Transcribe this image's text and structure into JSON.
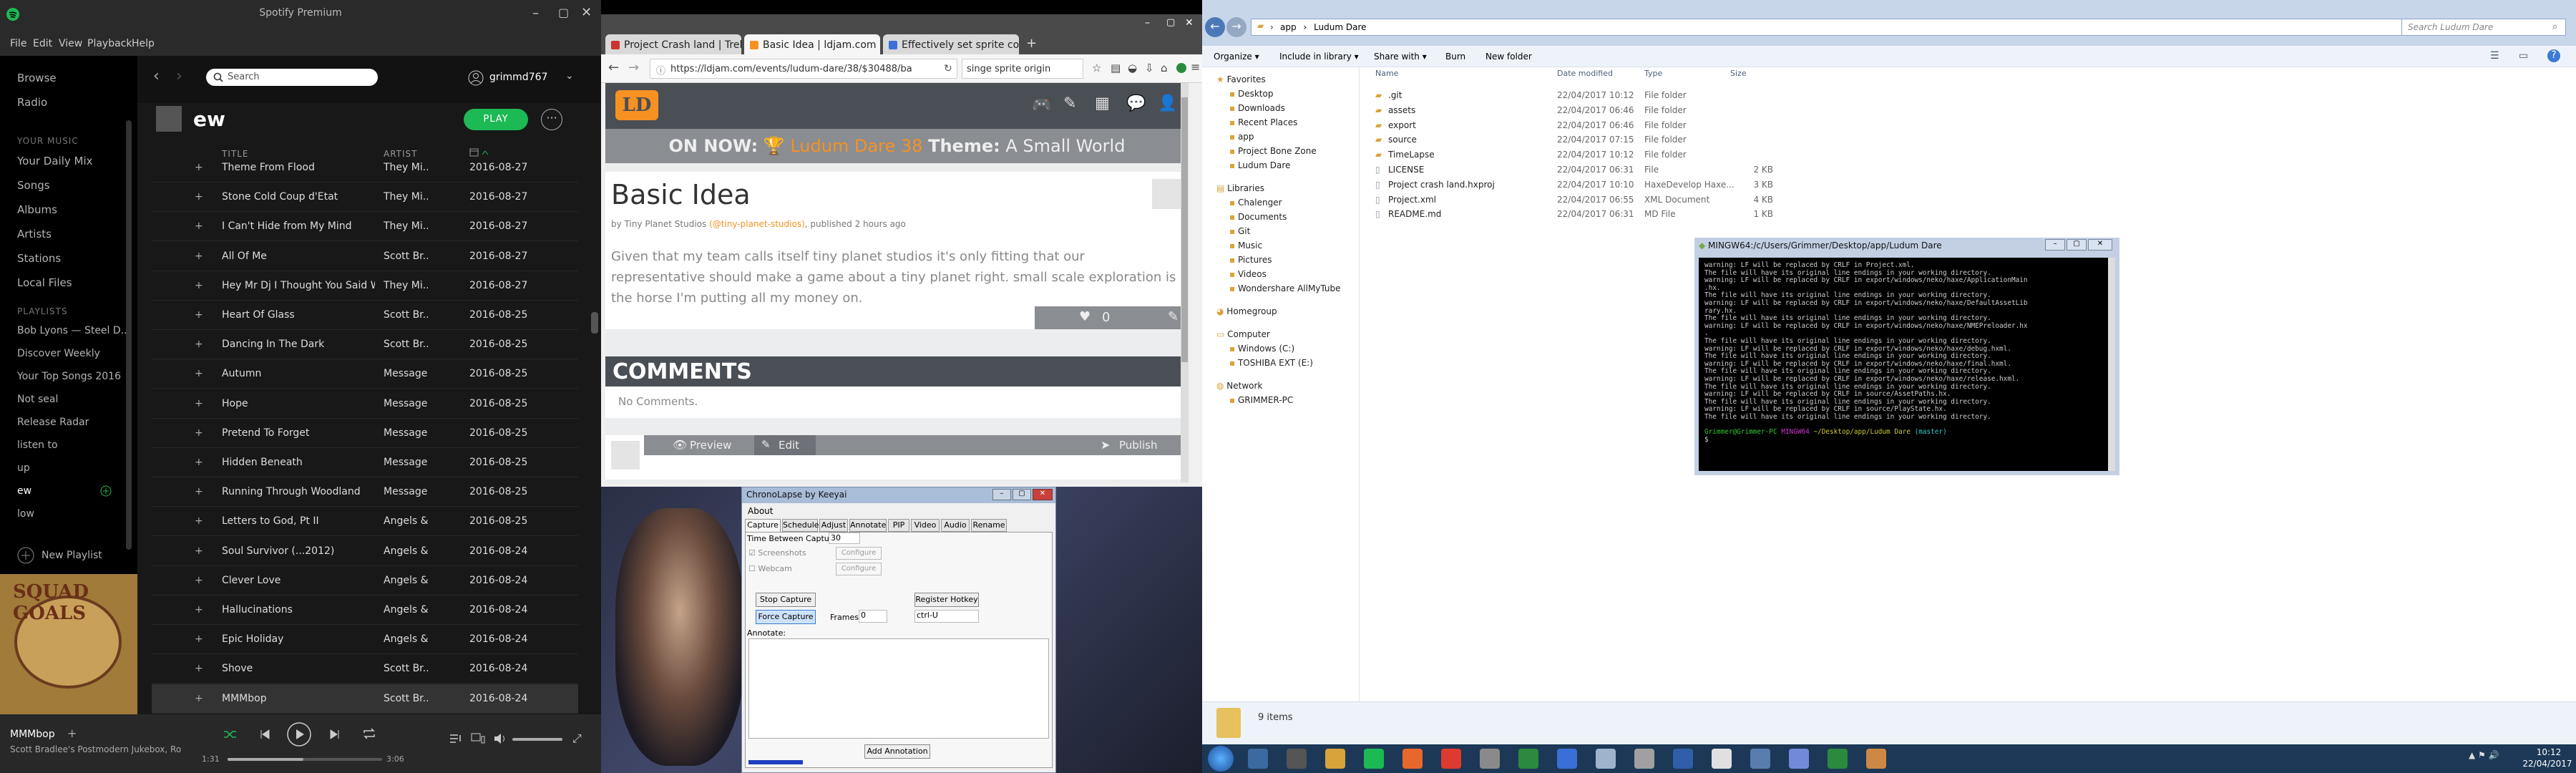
{
  "spotify": {
    "window_title": "Spotify Premium",
    "menu": [
      "File",
      "Edit",
      "View",
      "Playback",
      "Help"
    ],
    "nav": [
      "Browse",
      "Radio"
    ],
    "your_music_header": "YOUR MUSIC",
    "your_music": [
      "Your Daily Mix",
      "Songs",
      "Albums",
      "Artists",
      "Stations",
      "Local Files"
    ],
    "playlists_header": "PLAYLISTS",
    "playlists": [
      "Bob Lyons — Steel D...",
      "Discover Weekly",
      "Your Top Songs 2016",
      "Not seal",
      "Release Radar",
      "listen to",
      "up",
      "ew",
      "low"
    ],
    "new_playlist": "New Playlist",
    "search_placeholder": "Search",
    "user": "grimmd767",
    "playlist_name": "ew",
    "play_label": "PLAY",
    "col_title": "TITLE",
    "col_artist": "ARTIST",
    "tracks": [
      {
        "title": "Theme From Flood",
        "artist": "They Mi...",
        "date": "2016-08-27"
      },
      {
        "title": "Stone Cold Coup d'Etat",
        "artist": "They Mi...",
        "date": "2016-08-27"
      },
      {
        "title": "I Can't Hide from My Mind",
        "artist": "They Mi...",
        "date": "2016-08-27"
      },
      {
        "title": "All Of Me",
        "artist": "Scott Br...",
        "date": "2016-08-27"
      },
      {
        "title": "Hey Mr Dj I Thought You Said W...",
        "artist": "They Mi...",
        "date": "2016-08-27"
      },
      {
        "title": "Heart Of Glass",
        "artist": "Scott Br...",
        "date": "2016-08-25"
      },
      {
        "title": "Dancing In The Dark",
        "artist": "Scott Br...",
        "date": "2016-08-25"
      },
      {
        "title": "Autumn",
        "artist": "Message...",
        "date": "2016-08-25"
      },
      {
        "title": "Hope",
        "artist": "Message...",
        "date": "2016-08-25"
      },
      {
        "title": "Pretend To Forget",
        "artist": "Message...",
        "date": "2016-08-25"
      },
      {
        "title": "Hidden Beneath",
        "artist": "Message...",
        "date": "2016-08-25"
      },
      {
        "title": "Running Through Woodland",
        "artist": "Message...",
        "date": "2016-08-25"
      },
      {
        "title": "Letters to God, Pt II",
        "artist": "Angels &...",
        "date": "2016-08-25"
      },
      {
        "title": "Soul Survivor (...2012)",
        "artist": "Angels &...",
        "date": "2016-08-24"
      },
      {
        "title": "Clever Love",
        "artist": "Angels &...",
        "date": "2016-08-24"
      },
      {
        "title": "Hallucinations",
        "artist": "Angels &...",
        "date": "2016-08-24"
      },
      {
        "title": "Epic Holiday",
        "artist": "Angels &...",
        "date": "2016-08-24"
      },
      {
        "title": "Shove",
        "artist": "Scott Br...",
        "date": "2016-08-24"
      },
      {
        "title": "MMMbop",
        "artist": "Scott Br...",
        "date": "2016-08-24"
      }
    ],
    "now_playing_title": "MMMbop",
    "now_playing_artist": "Scott Bradlee's Postmodern Jukebox, Ro",
    "elapsed": "1:31",
    "duration": "3:06",
    "progress": 0.49,
    "album_art_text": "SQUAD GOALS"
  },
  "chrome": {
    "tabs": [
      "Project Crash land | Trello",
      "Basic Idea | ldjam.com",
      "Effectively set sprite coordin..."
    ],
    "url": "https://ldjam.com/events/ludum-dare/38/$30488/ba",
    "search_text": "singe sprite origin",
    "on_now_label": "ON NOW:",
    "event_name": "Ludum Dare 38",
    "theme_label": "Theme:",
    "theme_value": "A Small World",
    "post_title": "Basic Idea",
    "byline_prefix": "by Tiny Planet Studios",
    "byline_handle": "(@tiny-planet-studios)",
    "byline_suffix": ", published 2 hours ago",
    "body": "Given that my team calls itself tiny planet studios it's only fitting that our representative should make a game about a tiny planet right. small scale exploration is the horse I'm putting all my money on.",
    "likes": "0",
    "comments_header": "COMMENTS",
    "no_comments": "No Comments.",
    "preview": "Preview",
    "edit": "Edit",
    "publish": "Publish"
  },
  "chronolapse": {
    "title": "ChronoLapse by Keeyai",
    "menu": "About",
    "tabs": [
      "Capture",
      "Schedule",
      "Adjust",
      "Annotate",
      "PIP",
      "Video",
      "Audio",
      "Rename"
    ],
    "time_between": "Time Between Captures:",
    "time_value": "30",
    "screenshots": "Screenshots",
    "webcam": "Webcam",
    "configure": "Configure",
    "stop_capture": "Stop Capture",
    "register_hotkey": "Register Hotkey",
    "force_capture": "Force Capture",
    "frames_label": "Frames:",
    "frames_value": "0",
    "hotkey_value": "ctrl-U",
    "annotate_label": "Annotate:",
    "add_annotation": "Add Annotation"
  },
  "explorer": {
    "breadcrumb": [
      "app",
      "Ludum Dare"
    ],
    "search_placeholder": "Search Ludum Dare",
    "toolbar": [
      "Organize",
      "Include in library",
      "Share with",
      "Burn",
      "New folder"
    ],
    "nav": {
      "favorites": "Favorites",
      "fav_items": [
        "Desktop",
        "Downloads",
        "Recent Places",
        "app",
        "Project Bone Zone",
        "Ludum Dare"
      ],
      "libraries": "Libraries",
      "lib_items": [
        "Chalenger",
        "Documents",
        "Git",
        "Music",
        "Pictures",
        "Videos",
        "Wondershare AllMyTube"
      ],
      "homegroup": "Homegroup",
      "computer": "Computer",
      "comp_items": [
        "Windows (C:)",
        "TOSHIBA EXT (E:)"
      ],
      "network": "Network",
      "net_items": [
        "GRIMMER-PC"
      ]
    },
    "columns": [
      "Name",
      "Date modified",
      "Type",
      "Size"
    ],
    "files": [
      {
        "name": ".git",
        "date": "22/04/2017 10:12",
        "type": "File folder",
        "size": ""
      },
      {
        "name": "assets",
        "date": "22/04/2017 06:46",
        "type": "File folder",
        "size": ""
      },
      {
        "name": "export",
        "date": "22/04/2017 06:46",
        "type": "File folder",
        "size": ""
      },
      {
        "name": "source",
        "date": "22/04/2017 07:15",
        "type": "File folder",
        "size": ""
      },
      {
        "name": "TimeLapse",
        "date": "22/04/2017 10:12",
        "type": "File folder",
        "size": ""
      },
      {
        "name": "LICENSE",
        "date": "22/04/2017 06:31",
        "type": "File",
        "size": "2 KB"
      },
      {
        "name": "Project crash land.hxproj",
        "date": "22/04/2017 10:10",
        "type": "HaxeDevelop Haxe...",
        "size": "3 KB"
      },
      {
        "name": "Project.xml",
        "date": "22/04/2017 06:55",
        "type": "XML Document",
        "size": "4 KB"
      },
      {
        "name": "README.md",
        "date": "22/04/2017 06:31",
        "type": "MD File",
        "size": "1 KB"
      }
    ],
    "item_count": "9 items"
  },
  "terminal": {
    "title": "MINGW64:/c/Users/Grimmer/Desktop/app/Ludum Dare",
    "lines": [
      "warning: LF will be replaced by CRLF in Project.xml.",
      "The file will have its original line endings in your working directory.",
      "warning: LF will be replaced by CRLF in export/windows/neko/haxe/ApplicationMain",
      ".hx.",
      "The file will have its original line endings in your working directory.",
      "warning: LF will be replaced by CRLF in export/windows/neko/haxe/DefaultAssetLib",
      "rary.hx.",
      "The file will have its original line endings in your working directory.",
      "warning: LF will be replaced by CRLF in export/windows/neko/haxe/NMEPreloader.hx",
      ".",
      "The file will have its original line endings in your working directory.",
      "warning: LF will be replaced by CRLF in export/windows/neko/haxe/debug.hxml.",
      "The file will have its original line endings in your working directory.",
      "warning: LF will be replaced by CRLF in export/windows/neko/haxe/final.hxml.",
      "The file will have its original line endings in your working directory.",
      "warning: LF will be replaced by CRLF in export/windows/neko/haxe/release.hxml.",
      "The file will have its original line endings in your working directory.",
      "warning: LF will be replaced by CRLF in source/AssetPaths.hx.",
      "The file will have its original line endings in your working directory.",
      "warning: LF will be replaced by CRLF in source/PlayState.hx.",
      "The file will have its original line endings in your working directory."
    ],
    "prompt_user": "Grimmer@Grimmer-PC",
    "prompt_env": "MINGW64",
    "prompt_path": "~/Desktop/app/Ludum Dare",
    "prompt_branch": "(master)",
    "cursor": "$"
  },
  "taskbar": {
    "time": "10:12",
    "date": "22/04/2017"
  },
  "colors": {
    "spotify_green": "#1db954",
    "ld_orange": "#f79122",
    "ld_dark": "#4a4e55"
  }
}
